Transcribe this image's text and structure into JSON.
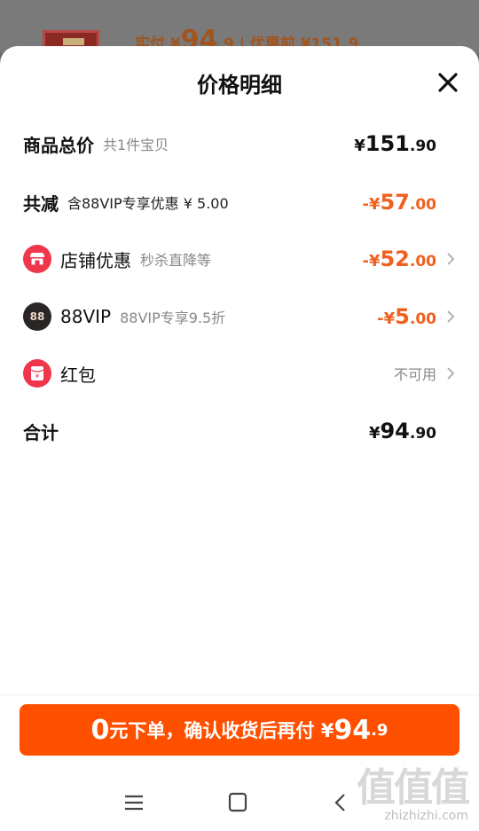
{
  "background": {
    "price_prefix": "实付 ¥",
    "price_int": "94",
    "price_dec": ".9",
    "price_suffix": " | 优惠前 ¥151.9"
  },
  "sheet": {
    "title": "价格明细"
  },
  "rows": [
    {
      "label": "商品总价",
      "sub": "共1件宝贝",
      "cur": "¥",
      "int": "151",
      "dec": ".90"
    },
    {
      "label": "共减",
      "sub": "含88VIP专享优惠 ¥ 5.00",
      "cur": "-¥",
      "int": "57",
      "dec": ".00"
    },
    {
      "label": "店铺优惠",
      "sub": "秒杀直降等",
      "cur": "-¥",
      "int": "52",
      "dec": ".00"
    },
    {
      "label": "88VIP",
      "sub": "88VIP专享9.5折",
      "icon_text": "88",
      "cur": "-¥",
      "int": "5",
      "dec": ".00"
    },
    {
      "label": "红包",
      "status": "不可用",
      "icon_text": "¥"
    },
    {
      "label": "合计",
      "cur": "¥",
      "int": "94",
      "dec": ".90"
    }
  ],
  "pay_button": {
    "zero": "0",
    "text": "元下单，确认收货后再付 ¥",
    "int": "94",
    "dec": ".9"
  },
  "watermark": {
    "big": "值值值",
    "small": "zhizhizhi.com"
  },
  "colors": {
    "accent": "#ff5000",
    "discount": "#f0601e",
    "badge_red": "#f0364a"
  }
}
